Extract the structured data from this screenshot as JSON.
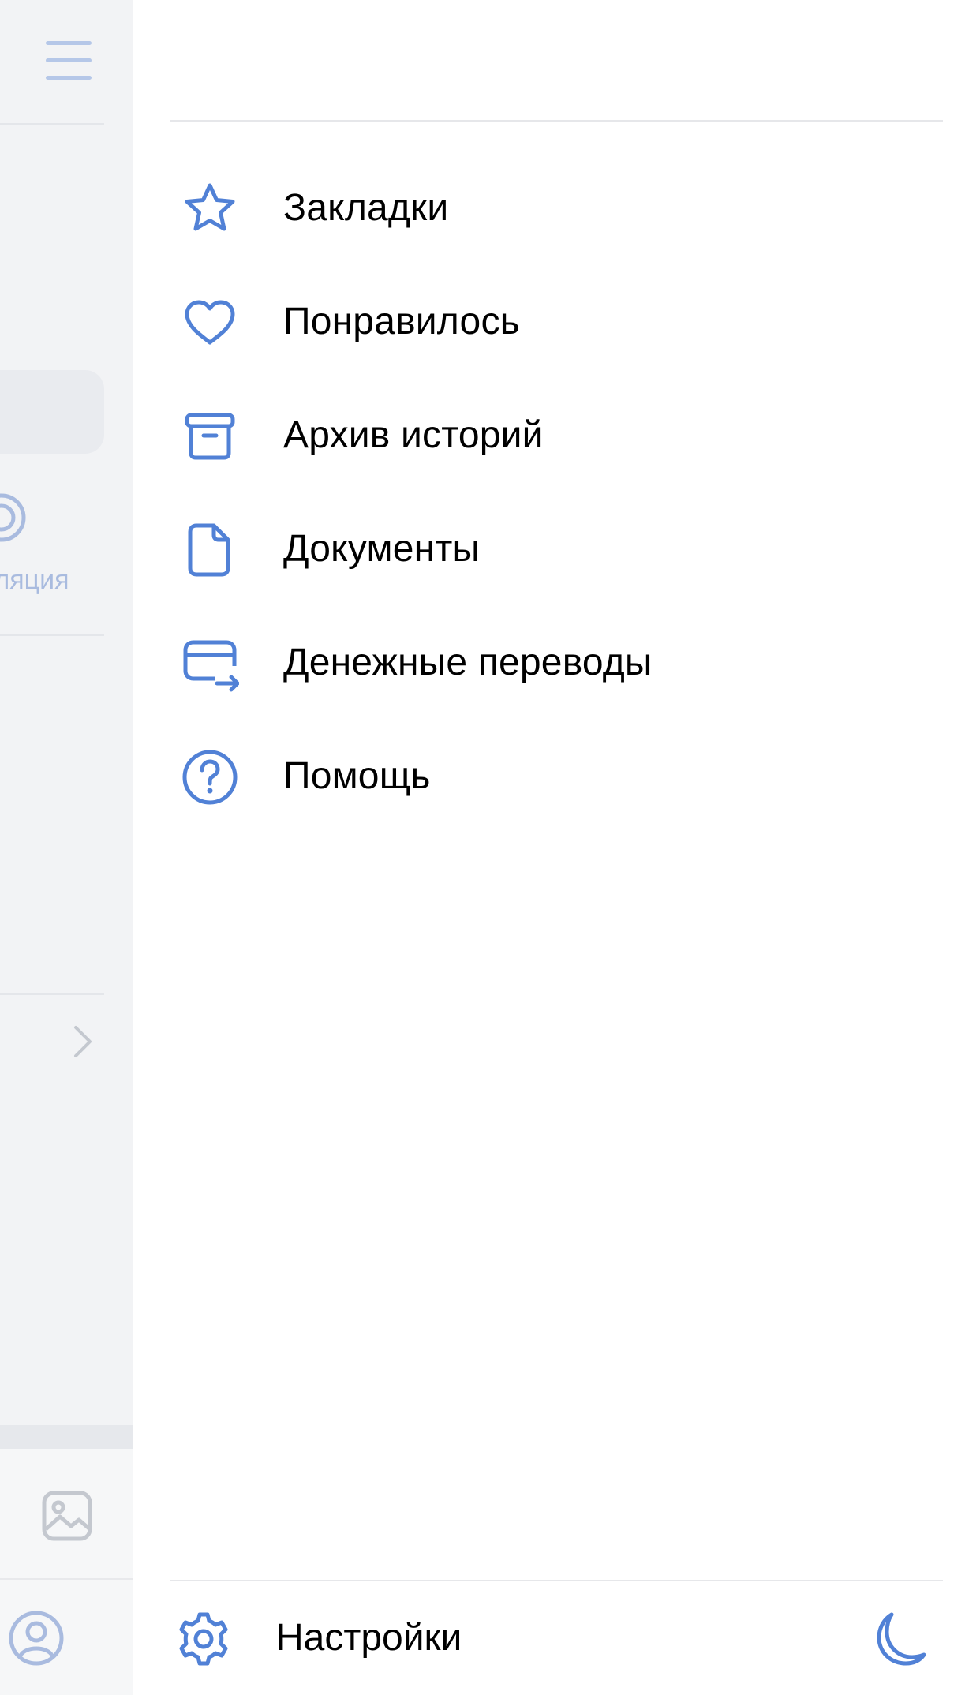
{
  "background_app": {
    "partial_label": "пляция"
  },
  "menu": {
    "items": [
      {
        "label": "Закладки",
        "icon": "star-icon"
      },
      {
        "label": "Понравилось",
        "icon": "heart-icon"
      },
      {
        "label": "Архив историй",
        "icon": "archive-icon"
      },
      {
        "label": "Документы",
        "icon": "document-icon"
      },
      {
        "label": "Денежные переводы",
        "icon": "money-transfer-icon"
      },
      {
        "label": "Помощь",
        "icon": "help-icon"
      }
    ]
  },
  "footer": {
    "settings_label": "Настройки",
    "settings_icon": "gear-icon",
    "theme_icon": "moon-icon"
  },
  "colors": {
    "accent": "#5181d6",
    "text": "#000000",
    "divider": "#e6e7ea",
    "background_app": "#f2f3f5"
  }
}
